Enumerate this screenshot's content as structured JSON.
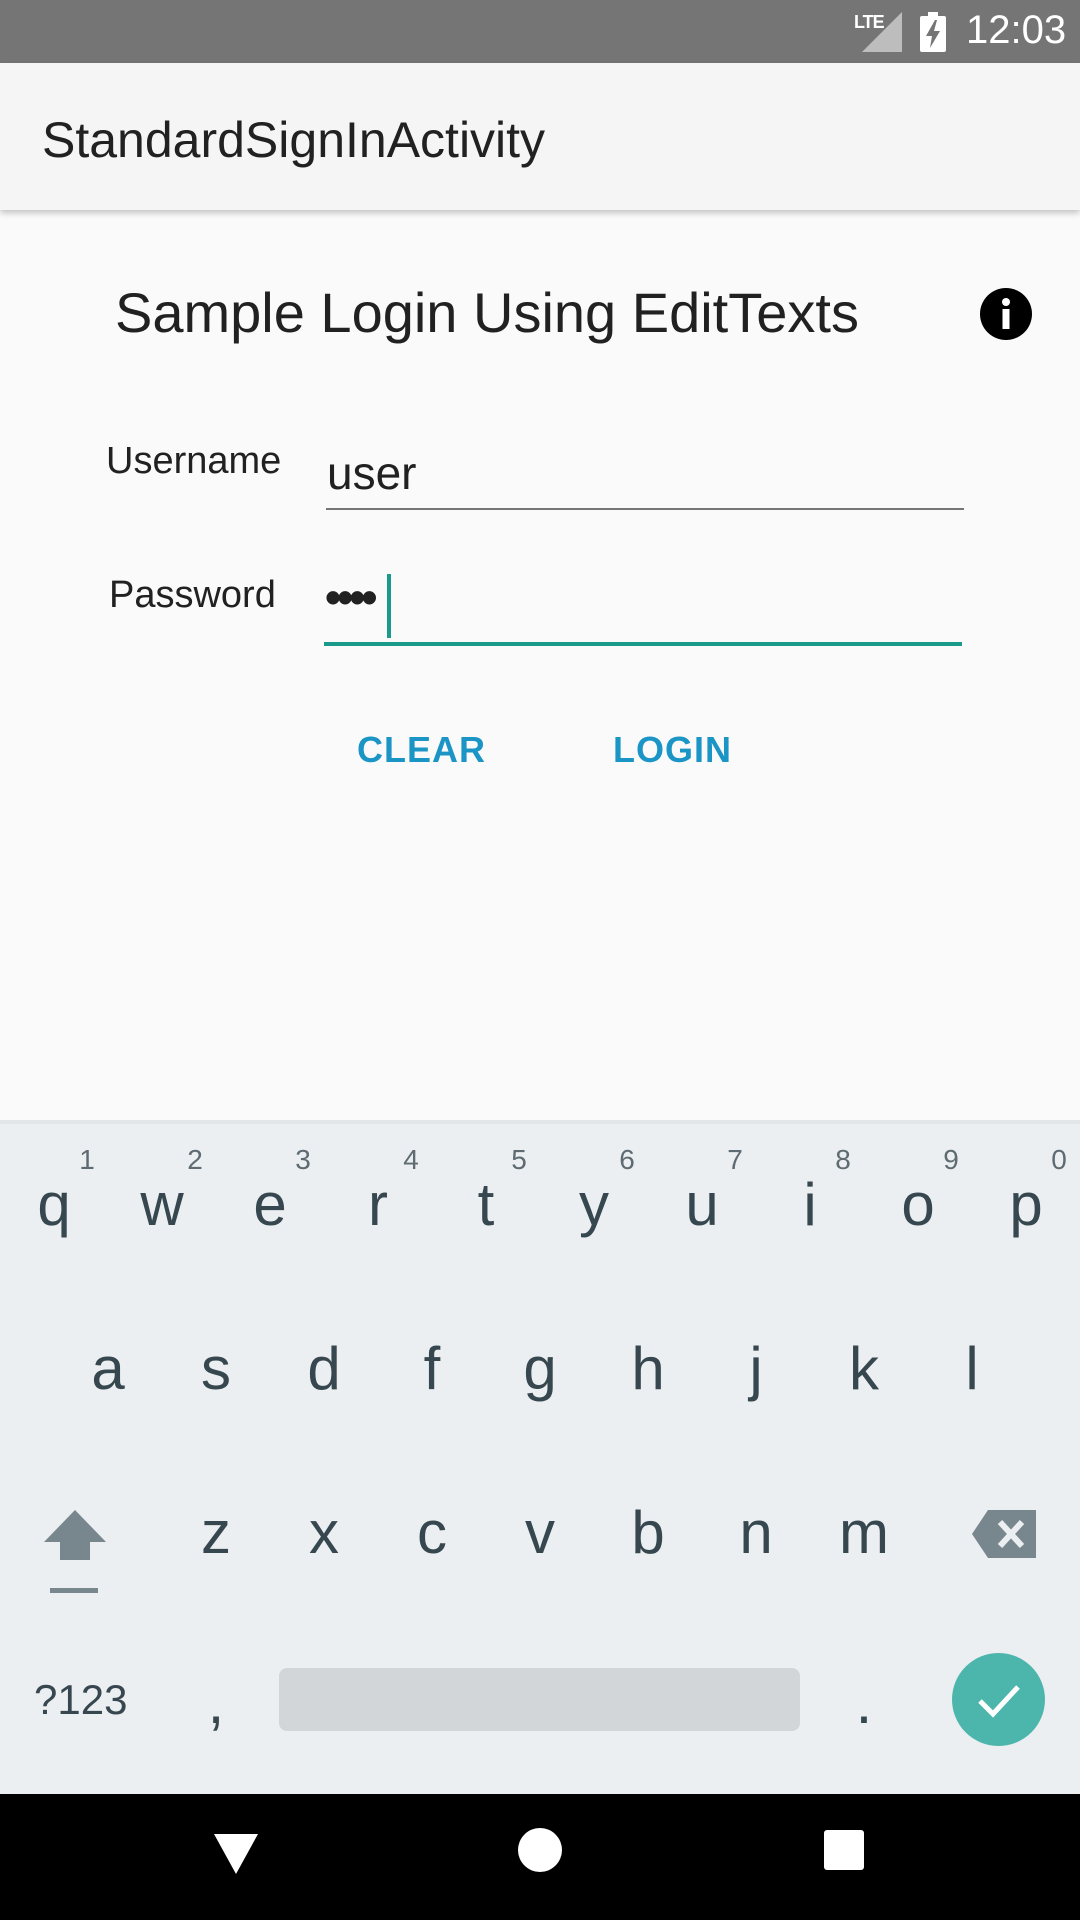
{
  "status_bar": {
    "network": "LTE",
    "time": "12:03"
  },
  "app_bar": {
    "title": "StandardSignInActivity"
  },
  "form": {
    "heading": "Sample Login Using EditTexts",
    "username_label": "Username",
    "username_value": "user",
    "password_label": "Password",
    "password_value": "••••",
    "clear_label": "CLEAR",
    "login_label": "LOGIN"
  },
  "keyboard": {
    "row1": [
      "q",
      "w",
      "e",
      "r",
      "t",
      "y",
      "u",
      "i",
      "o",
      "p"
    ],
    "row1_hints": [
      "1",
      "2",
      "3",
      "4",
      "5",
      "6",
      "7",
      "8",
      "9",
      "0"
    ],
    "row2": [
      "a",
      "s",
      "d",
      "f",
      "g",
      "h",
      "j",
      "k",
      "l"
    ],
    "row3": [
      "z",
      "x",
      "c",
      "v",
      "b",
      "n",
      "m"
    ],
    "symbols_label": "?123",
    "comma": ",",
    "period": "."
  },
  "colors": {
    "accent": "#1a9a8a",
    "button_text": "#1b95c6",
    "enter_key": "#4db6ac"
  }
}
